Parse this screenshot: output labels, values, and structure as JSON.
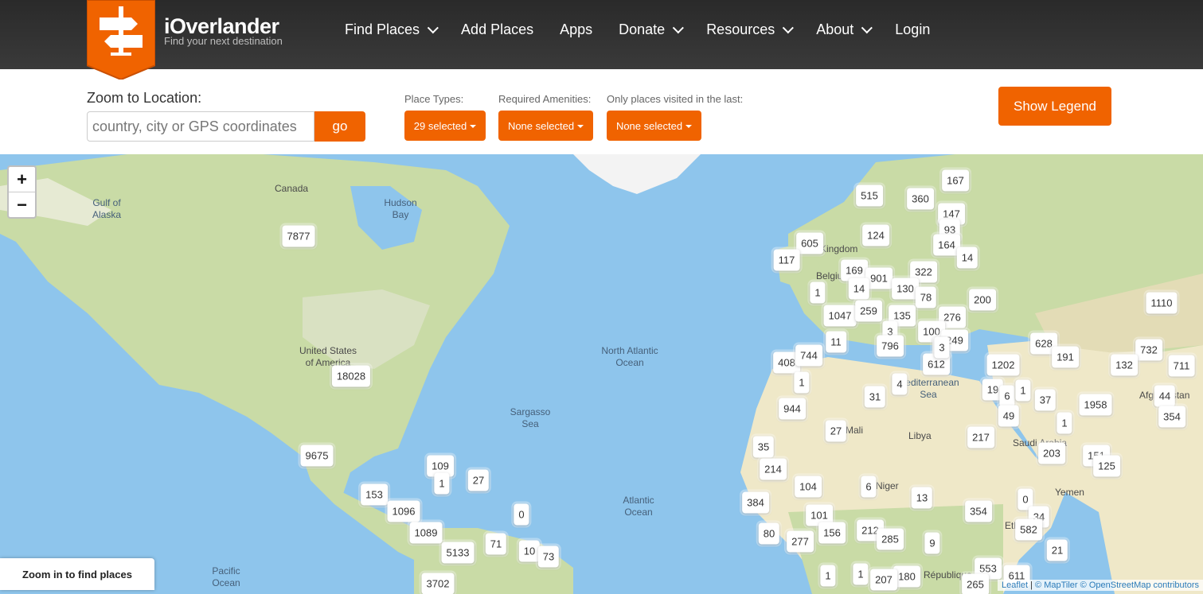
{
  "brand": {
    "title": "iOverlander",
    "tagline": "Find your next destination"
  },
  "nav": [
    {
      "label": "Find Places",
      "dropdown": true
    },
    {
      "label": "Add Places",
      "dropdown": false
    },
    {
      "label": "Apps",
      "dropdown": false
    },
    {
      "label": "Donate",
      "dropdown": true
    },
    {
      "label": "Resources",
      "dropdown": true
    },
    {
      "label": "About",
      "dropdown": true
    },
    {
      "label": "Login",
      "dropdown": false
    }
  ],
  "search": {
    "label": "Zoom to Location:",
    "placeholder": "country, city or GPS coordinates",
    "go_label": "go"
  },
  "filters": {
    "place_types": {
      "label": "Place Types:",
      "value": "29 selected"
    },
    "amenities": {
      "label": "Required Amenities:",
      "value": "None selected"
    },
    "visited": {
      "label": "Only places visited in the last:",
      "value": "None selected"
    }
  },
  "legend_button": "Show Legend",
  "map": {
    "zoom_in": "+",
    "zoom_out": "−",
    "hint": "Zoom in to find places",
    "attribution": {
      "leaflet": "Leaflet",
      "sep": " | ",
      "maptiler": "© MapTiler",
      "osm": "© OpenStreetMap contributors"
    },
    "labels": [
      "Canada",
      "Hudson Bay",
      "Gulf of Alaska",
      "United States of America",
      "North Atlantic Ocean",
      "Sargasso Sea",
      "Atlantic Ocean",
      "Pacific Ocean",
      "Libya",
      "Mediterranean Sea",
      "Saudi Arabia",
      "Yemen",
      "Afghanistan",
      "République",
      "Belgium",
      "Kingdom",
      "Ethiopia",
      "Niger",
      "Mali"
    ],
    "clusters": [
      "7877",
      "18028",
      "9675",
      "109",
      "1",
      "27",
      "153",
      "1096",
      "1089",
      "5133",
      "71",
      "0",
      "10",
      "73",
      "3702",
      "167",
      "515",
      "360",
      "147",
      "93",
      "124",
      "164",
      "14",
      "605",
      "117",
      "169",
      "901",
      "322",
      "1",
      "14",
      "130",
      "78",
      "200",
      "1110",
      "1047",
      "259",
      "135",
      "276",
      "3",
      "100",
      "249",
      "11",
      "796",
      "3",
      "612",
      "628",
      "191",
      "732",
      "132",
      "711",
      "408",
      "744",
      "1",
      "1202",
      "31",
      "4",
      "19",
      "6",
      "1",
      "37",
      "944",
      "49",
      "1958",
      "1",
      "44",
      "354",
      "27",
      "217",
      "203",
      "151",
      "35",
      "214",
      "104",
      "6",
      "13",
      "0",
      "384",
      "101",
      "354",
      "34",
      "80",
      "277",
      "156",
      "212",
      "285",
      "9",
      "582",
      "21",
      "1",
      "1",
      "180",
      "207",
      "553",
      "611",
      "265",
      "125",
      "3"
    ]
  }
}
